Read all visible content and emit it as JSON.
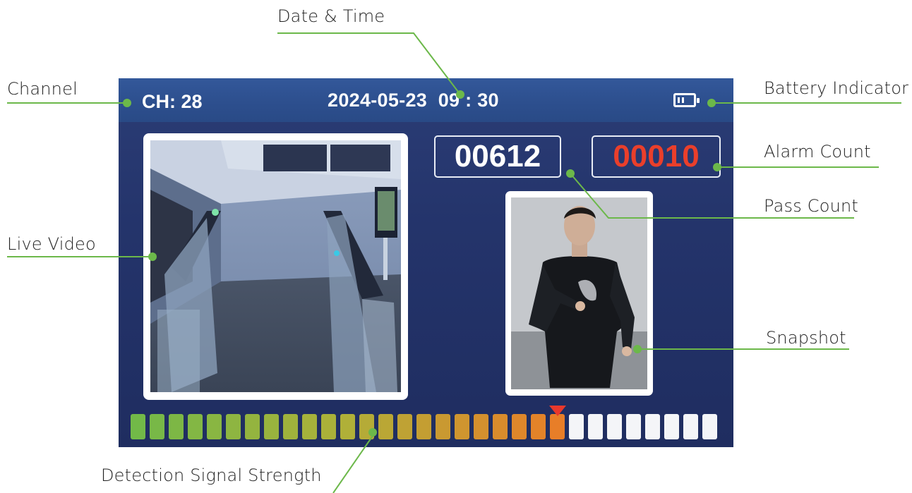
{
  "callouts": {
    "date_time": "Date & Time",
    "channel": "Channel",
    "battery": "Battery Indicator",
    "alarm_count": "Alarm Count",
    "pass_count": "Pass Count",
    "live_video": "Live Video",
    "snapshot": "Snapshot",
    "signal": "Detection Signal Strength"
  },
  "screen": {
    "channel": "CH: 28",
    "date_time": "2024-05-23  09 : 30",
    "battery_icon": "battery-icon",
    "pass_count": "00612",
    "alarm_count": "00010",
    "signal": {
      "total_segments": 31,
      "active_segments": 23,
      "level_fraction": 0.742
    }
  },
  "colors": {
    "leader_line": "#6cb84a",
    "alarm_red": "#ea3f2b",
    "screen_bg": "#24346b",
    "topbar_bg": "#2d4f8e"
  }
}
